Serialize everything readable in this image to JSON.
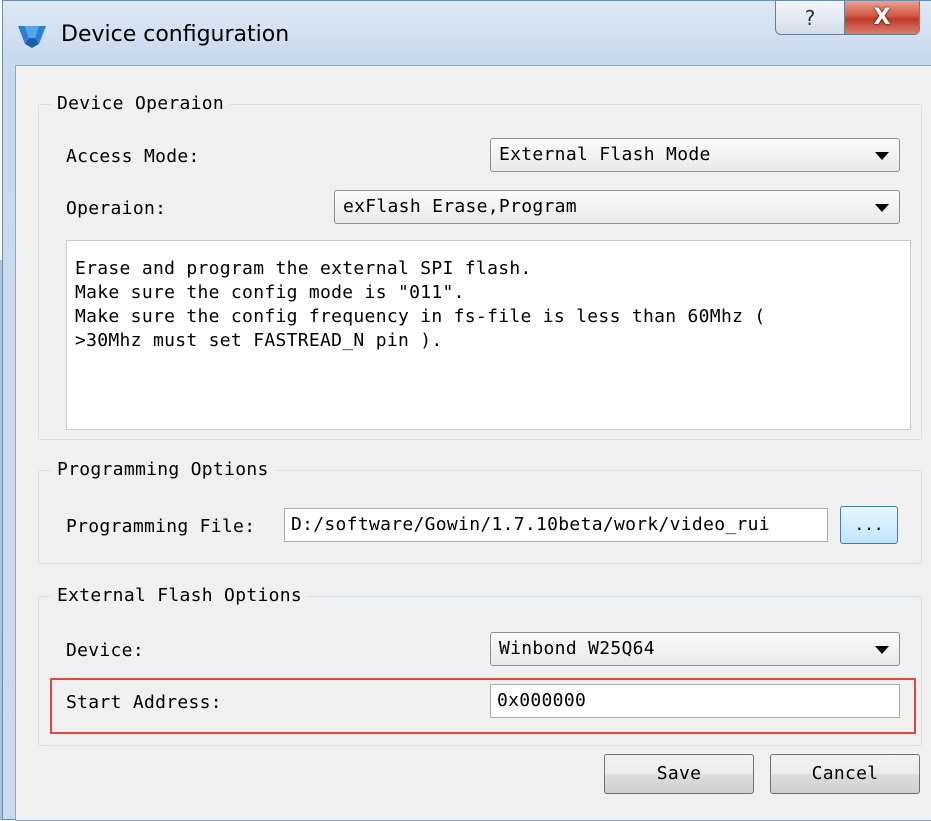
{
  "window": {
    "title": "Device configuration",
    "help_label": "?",
    "close_label": "X"
  },
  "device_operation": {
    "group_title": "Device Operaion",
    "access_mode_label": "Access Mode:",
    "access_mode_value": "External Flash Mode",
    "operation_label": "Operaion:",
    "operation_value": "exFlash Erase,Program",
    "description": "Erase and program the external SPI flash.\nMake sure the config mode is \"011\".\nMake sure the config frequency in fs-file is less than 60Mhz (\n>30Mhz must set FASTREAD_N pin )."
  },
  "programming_options": {
    "group_title": "Programming Options",
    "file_label": "Programming File:",
    "file_value": "D:/software/Gowin/1.7.10beta/work/video_rui",
    "browse_label": "..."
  },
  "external_flash_options": {
    "group_title": "External Flash Options",
    "device_label": "Device:",
    "device_value": "Winbond W25Q64",
    "start_address_label": "Start Address:",
    "start_address_value": "0x000000"
  },
  "footer": {
    "save_label": "Save",
    "cancel_label": "Cancel"
  },
  "colors": {
    "highlight_border": "#e8463c",
    "close_button": "#c0392b",
    "title_bar": "#c8d9ec"
  },
  "icons": {
    "app_logo": "gowin-logo-icon",
    "dropdown_arrow": "triangle-down-icon"
  }
}
